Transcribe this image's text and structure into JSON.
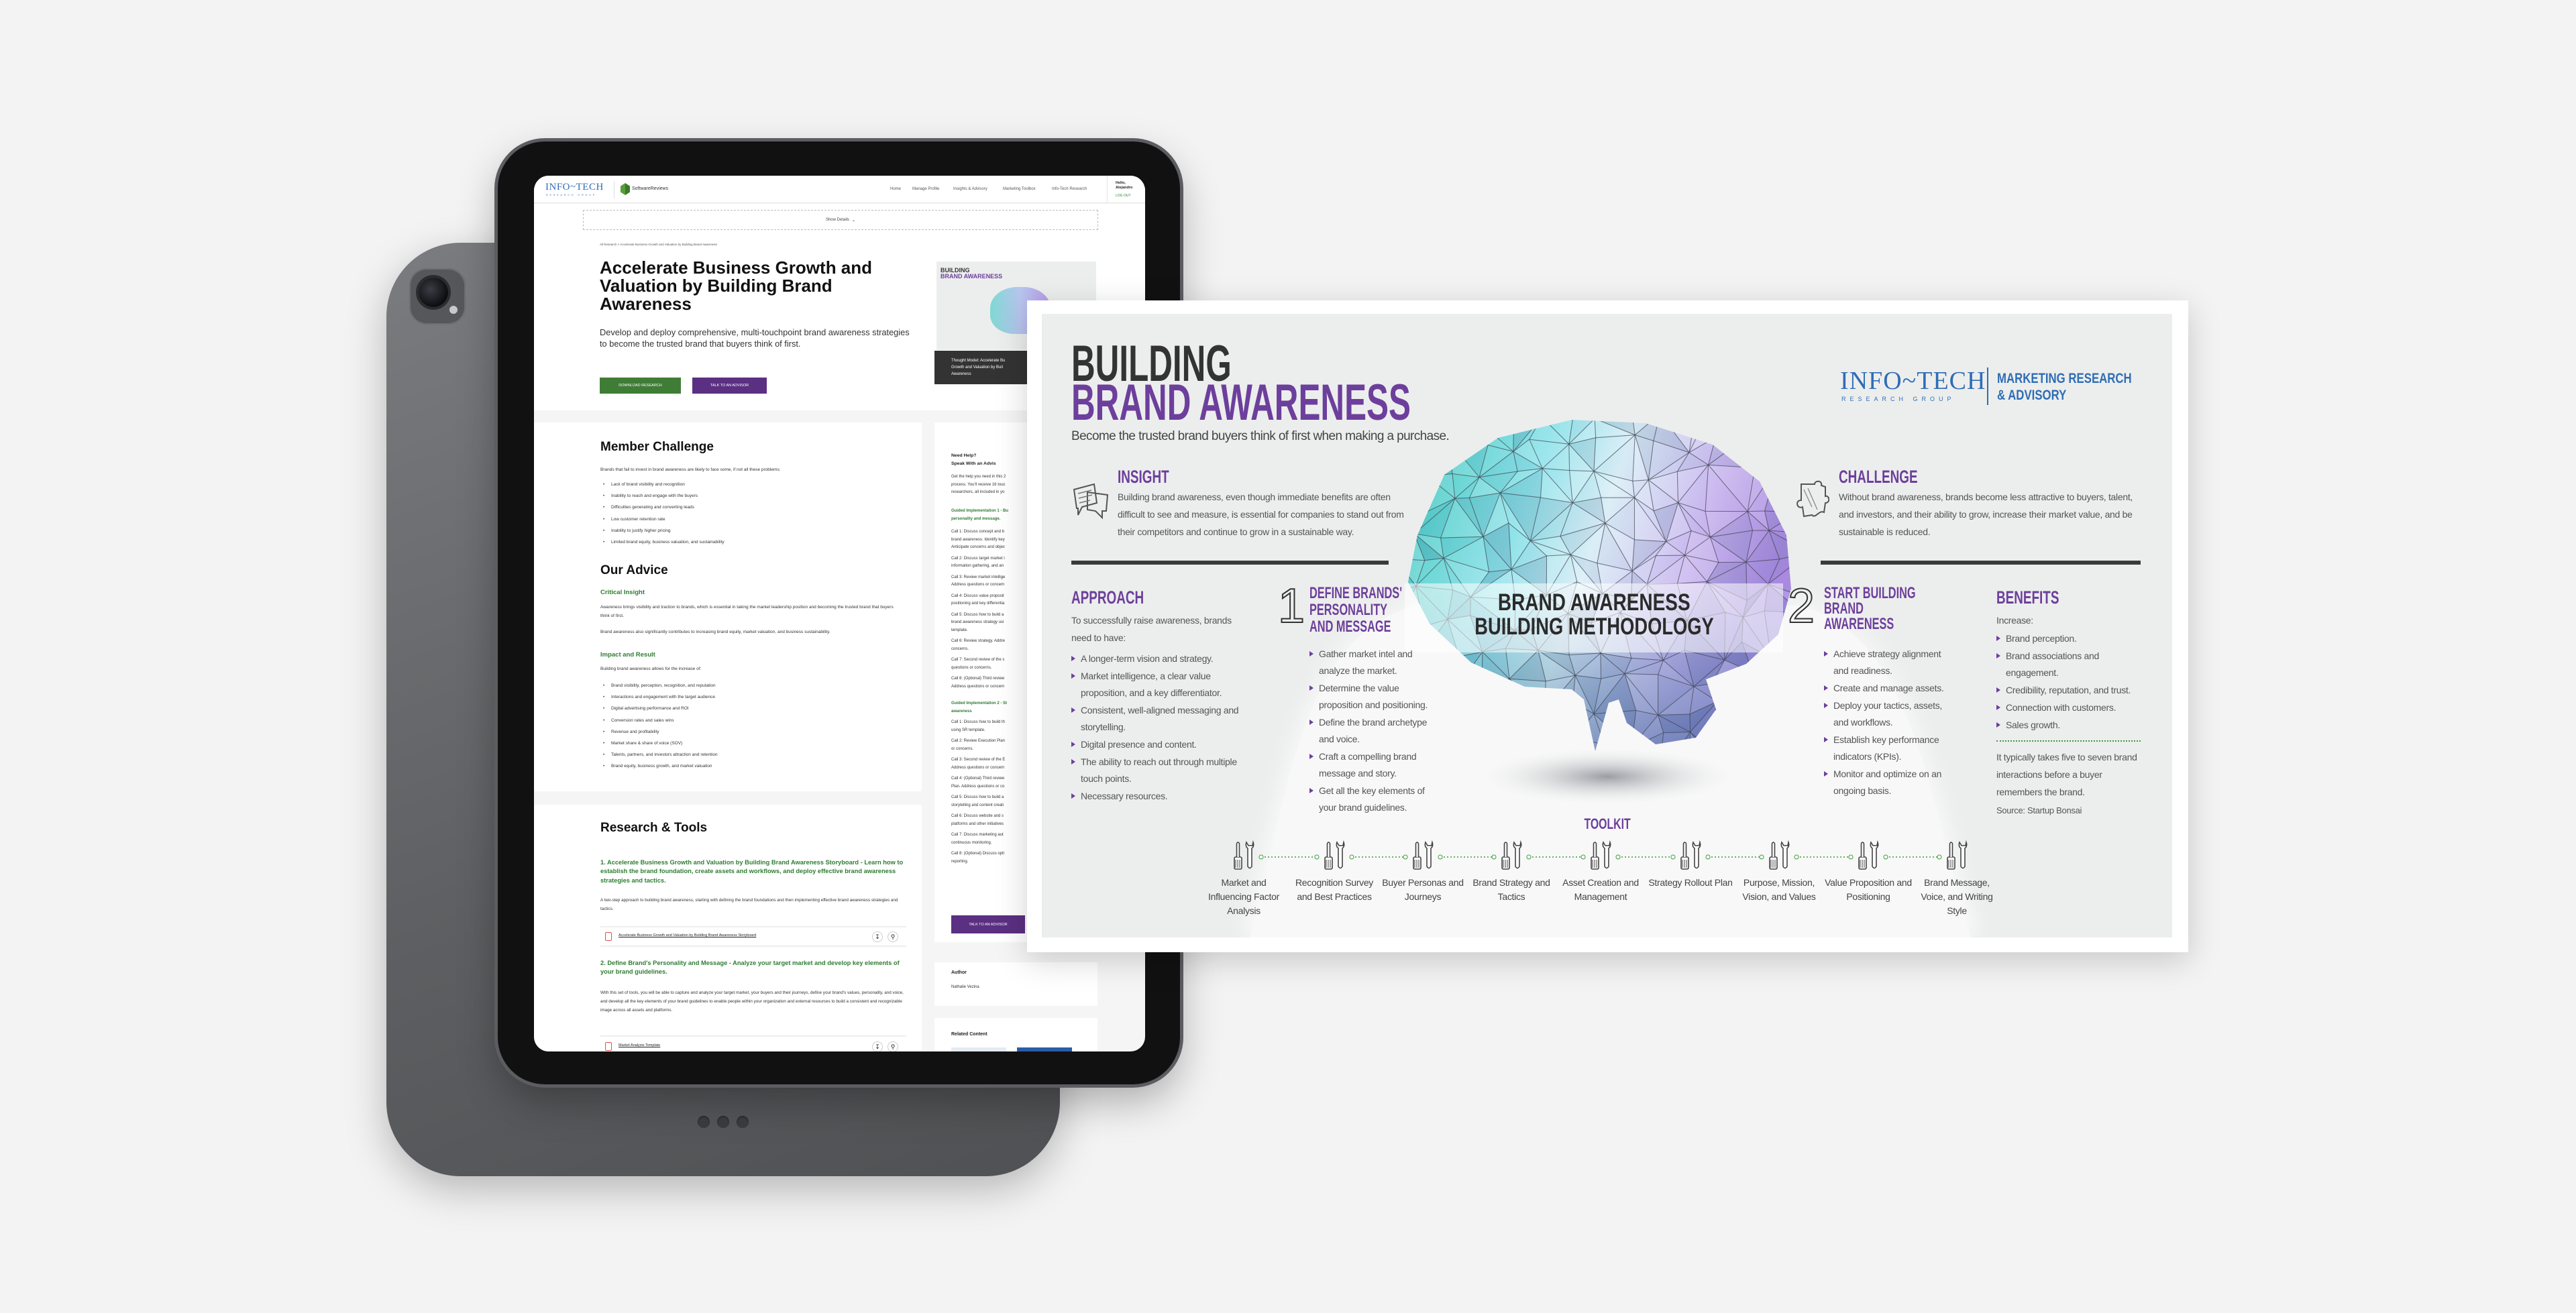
{
  "website": {
    "header": {
      "logo": "INFO~TECH",
      "logo_sub": "RESEARCH GROUP",
      "partner_logo": "SoftwareReviews",
      "nav": [
        "Home",
        "Manage Profile",
        "Insights & Advisory",
        "Marketing Toolbox",
        "Info-Tech Research"
      ],
      "greeting": "Hello,",
      "user_name": "Alejandro",
      "logout": "LOG OUT"
    },
    "show_details": "Show Details",
    "breadcrumb": "All Research > Accelerate Business Growth and Valuation by Building Brand Awareness",
    "hero": {
      "title": "Accelerate Business Growth and Valuation by Building Brand Awareness",
      "subtitle": "Develop and deploy comprehensive, multi-touchpoint brand awareness strategies to become the trusted brand that buyers think of first.",
      "download_button": "DOWNLOAD RESEARCH",
      "advisor_button": "TALK TO AN ADVISOR",
      "thumbnail": {
        "line1": "BUILDING",
        "line2": "BRAND AWARENESS",
        "caption_lines": [
          "Thought Model: Accelerate Bu",
          "Growth and Valuation by Buil",
          "Awareness"
        ]
      }
    },
    "member_challenge": {
      "heading": "Member Challenge",
      "intro": "Brands that fail to invest in brand awareness are likely to face some, if not all these problems:",
      "problems": [
        "Lack of brand visibility and recognition",
        "Inability to reach and engage with the buyers",
        "Difficulties generating and converting leads",
        "Low customer retention rate",
        "Inability to justify higher pricing",
        "Limited brand equity, business valuation, and sustainability"
      ]
    },
    "our_advice": {
      "heading": "Our Advice",
      "critical_insight_heading": "Critical Insight",
      "critical_insight_p1": "Awareness brings visibility and traction to brands, which is essential in taking the market leadership position and becoming the trusted brand that buyers think of first.",
      "critical_insight_p2": "Brand awareness also significantly contributes to increasing brand equity, market valuation, and business sustainability.",
      "impact_heading": "Impact and Result",
      "impact_intro": "Building brand awareness allows for the increase of:",
      "impacts": [
        "Brand visibility, perception, recognition, and reputation",
        "Interactions and engagement with the target audience",
        "Digital advertising performance and ROI",
        "Conversion rates and sales wins",
        "Revenue and profitability",
        "Market share & share of voice (SOV)",
        "Talents, partners, and investors attraction and retention",
        "Brand equity, business growth, and market valuation"
      ]
    },
    "research_tools": {
      "heading": "Research & Tools",
      "items": [
        {
          "title": "1. Accelerate Business Growth and Valuation by Building Brand Awareness Storyboard - Learn how to establish the brand foundation, create assets and workflows, and deploy effective brand awareness strategies and tactics.",
          "description": "A two-step approach to building brand awareness, starting with defining the brand foundations and then implementing effective brand awareness strategies and tactics.",
          "file": "Accelerate Business Growth and Valuation by Building Brand Awareness Storyboard"
        },
        {
          "title": "2. Define Brand's Personality and Message - Analyze your target market and develop key elements of your brand guidelines.",
          "description": "With this set of tools, you will be able to capture and analyze your target market, your buyers and their journeys, define your brand's values, personality, and voice, and develop all the key elements of your brand guidelines to enable people within your organization and external resources to build a consistent and recognizable image across all assets and platforms.",
          "file": "Market Analysis Template"
        }
      ]
    },
    "sidebar": {
      "help_title_1": "Need Help?",
      "help_title_2": "Speak With an Advis",
      "help_text": [
        "Get the help you need in this 2",
        "process. You'll receive 16 touc",
        "researchers, all included in yo"
      ],
      "guided_1_title": [
        "Guided Implementation 1 - Bu",
        "personality and message."
      ],
      "guided_1_calls": [
        [
          "Call 1: Discuss concept and b",
          "brand awareness. Identify key",
          "Anticipate concerns and objec"
        ],
        [
          "Call 2: Discuss target market i",
          "information gathering, and an"
        ],
        [
          "Call 3: Review market intellige",
          "Address questions or concern"
        ],
        [
          "Call 4: Discuss value proposit",
          "positioning and key differentia"
        ],
        [
          "Call 5: Discuss how to build a",
          "brand awareness strategy usi",
          "template."
        ],
        [
          "Call 6: Review strategy. Addre",
          "concerns."
        ],
        [
          "Call 7: Second review of the s",
          "questions or concerns."
        ],
        [
          "Call 8: (Optional) Third review",
          "Address questions or concern"
        ]
      ],
      "guided_2_title": [
        "Guided Implementation 2 - St",
        "awareness"
      ],
      "guided_2_calls": [
        [
          "Call 1: Discuss how to build th",
          "using SR template."
        ],
        [
          "Call 2: Review Execution Plan",
          "or concerns."
        ],
        [
          "Call 3: Second review of the E",
          "Address questions or concern"
        ],
        [
          "Call 4: (Optional) Third review",
          "Plan. Address questions or co"
        ],
        [
          "Call 5: Discuss how to build a",
          "storytelling and content creati"
        ],
        [
          "Call 6: Discuss website and s",
          "platforms and other initiatives"
        ],
        [
          "Call 7: Discuss marketing aut",
          "continuous monitoring."
        ],
        [
          "Call 8: (Optional) Discuss opti",
          "reporting."
        ]
      ],
      "advisor_button": "TALK TO AN ADVISOR",
      "author_label": "Author",
      "author_name": "Nathalie Vezina",
      "related_label": "Related Content"
    }
  },
  "infographic": {
    "title_line1": "BUILDING",
    "title_line2": "BRAND AWARENESS",
    "subtitle": "Become the trusted brand buyers think of first when making a purchase.",
    "logo": "INFO~TECH",
    "logo_sub": "RESEARCH GROUP",
    "logo_division": [
      "MARKETING RESEARCH",
      "& ADVISORY"
    ],
    "insight": {
      "heading": "INSIGHT",
      "text": "Building brand awareness, even though immediate benefits are often difficult to see and measure, is essential for companies to stand out from their competitors and continue to grow in a sustainable way."
    },
    "challenge": {
      "heading": "CHALLENGE",
      "text": "Without brand awareness, brands become less attractive to buyers, talent, and investors, and their ability to grow, increase their market value, and be sustainable is reduced."
    },
    "methodology": [
      "BRAND AWARENESS",
      "BUILDING METHODOLOGY"
    ],
    "approach": {
      "heading": "APPROACH",
      "intro": "To successfully raise awareness, brands need to have:",
      "items": [
        "A longer-term vision and strategy.",
        "Market intelligence, a clear value proposition, and a key differentiator.",
        "Consistent, well-aligned messaging and storytelling.",
        "Digital presence and content.",
        "The ability to reach out through multiple touch points.",
        "Necessary resources."
      ]
    },
    "step1": {
      "number": "1",
      "heading": [
        "DEFINE BRANDS'",
        "PERSONALITY",
        "AND MESSAGE"
      ],
      "items": [
        "Gather market intel and analyze the market.",
        "Determine the value proposition and positioning.",
        "Define the brand archetype and voice.",
        "Craft a compelling brand message and story.",
        "Get all the key elements of your brand guidelines."
      ]
    },
    "step2": {
      "number": "2",
      "heading": [
        "START BUILDING",
        "BRAND",
        "AWARENESS"
      ],
      "items": [
        "Achieve strategy alignment and readiness.",
        "Create and manage assets.",
        "Deploy your tactics, assets, and workflows.",
        "Establish key performance indicators (KPIs).",
        "Monitor and optimize on an ongoing basis."
      ]
    },
    "benefits": {
      "heading": "BENEFITS",
      "intro": "Increase:",
      "items": [
        "Brand perception.",
        "Brand associations and engagement.",
        "Credibility, reputation, and trust.",
        "Connection with customers.",
        "Sales growth."
      ],
      "stat": "It typically takes five to seven brand interactions before a buyer remembers the brand.",
      "source": "Source: Startup Bonsai"
    },
    "toolkit": {
      "heading": "TOOLKIT",
      "tools": [
        "Market and Influencing Factor Analysis",
        "Recognition Survey and Best Practices",
        "Buyer Personas and Journeys",
        "Brand Strategy and Tactics",
        "Asset Creation and Management",
        "Strategy Rollout Plan",
        "Purpose, Mission, Vision, and Values",
        "Value Proposition and Positioning",
        "Brand Message, Voice, and Writing Style"
      ]
    }
  },
  "colors": {
    "infotech_purple": "#6d3f9c",
    "infotech_blue": "#2f6db5",
    "website_green": "#2e7d32",
    "download_button": "#3f7d36",
    "advisor_button": "#5b2f82",
    "brain_teal": "#3cc6bd",
    "brain_purple": "#b293e6"
  }
}
